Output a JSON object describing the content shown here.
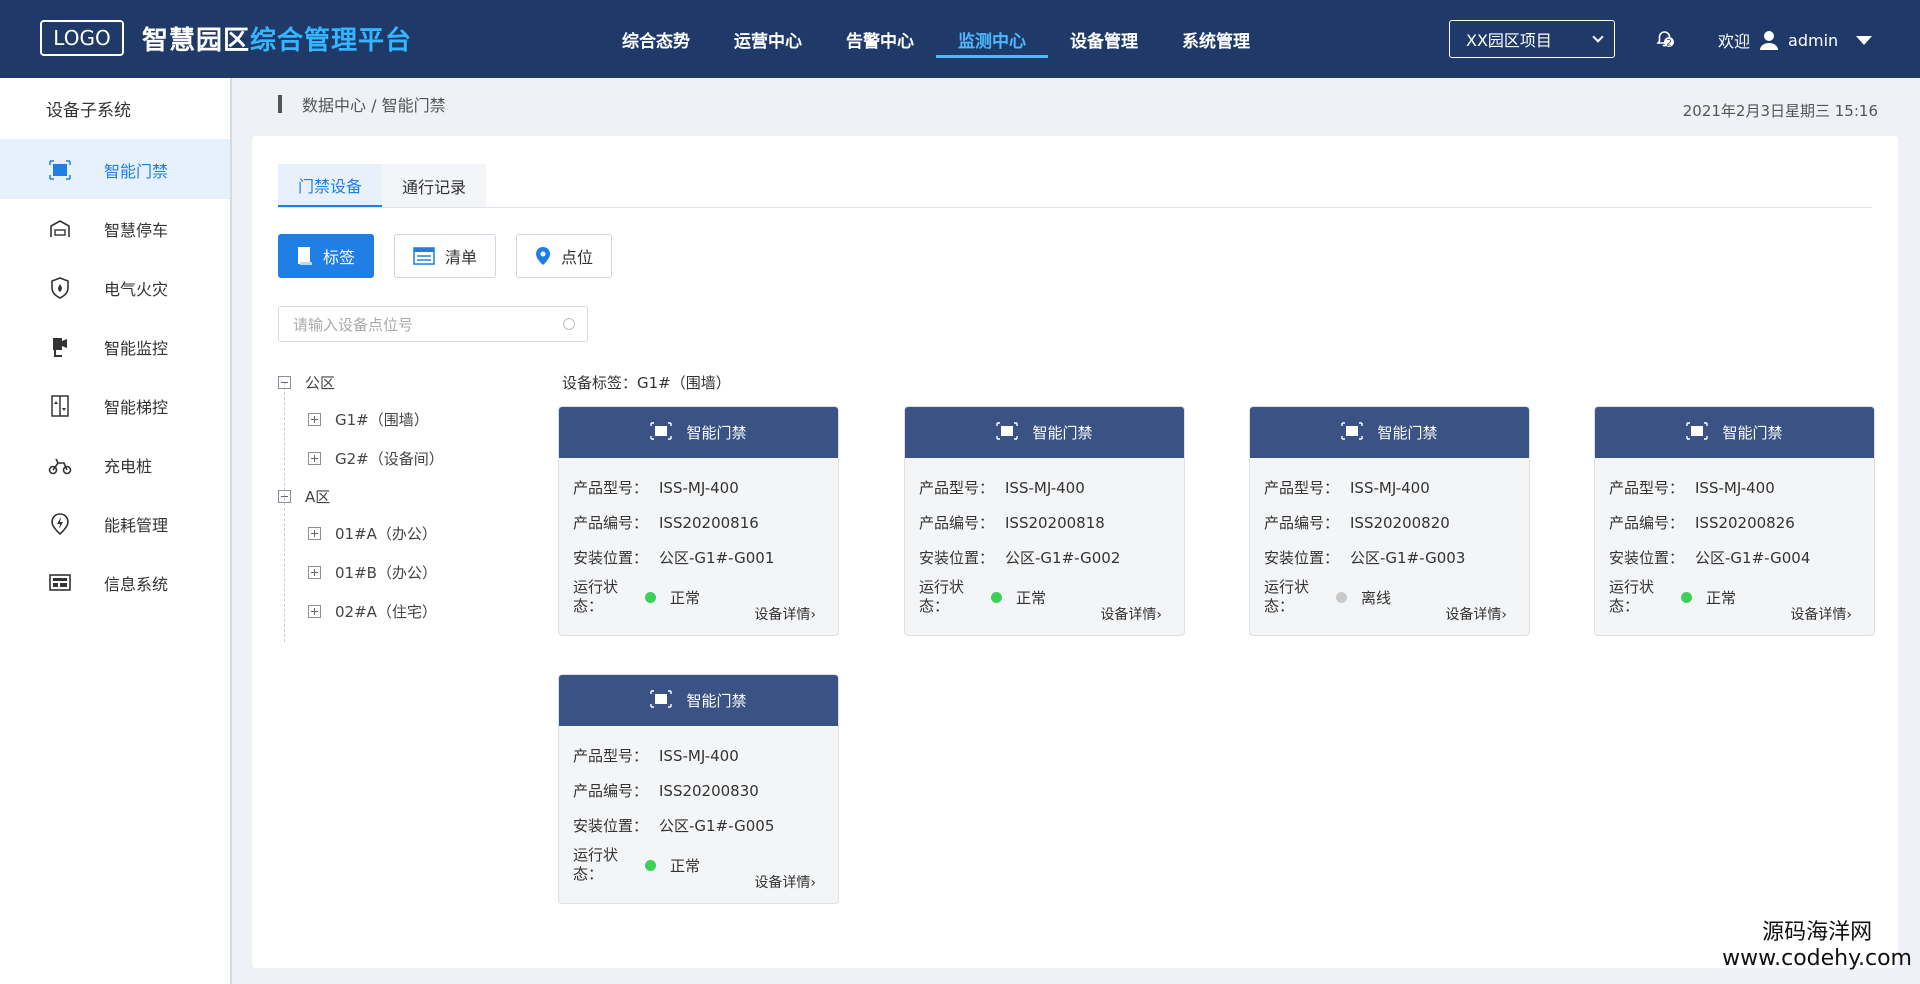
{
  "header": {
    "logo": "LOGO",
    "title_part1": "智慧园区",
    "title_part2": "综合管理平台",
    "nav": [
      "综合态势",
      "运营中心",
      "告警中心",
      "监测中心",
      "设备管理",
      "系统管理"
    ],
    "active_nav": "监测中心",
    "project": "XX园区项目",
    "alert_count": "2",
    "welcome": "欢迎",
    "user": "admin",
    "accent_color": "#33b6ff",
    "bg_color": "#1f3a68"
  },
  "sidebar": {
    "title": "设备子系统",
    "items": [
      {
        "label": "智能门禁",
        "icon": "door-access-icon"
      },
      {
        "label": "智慧停车",
        "icon": "parking-icon"
      },
      {
        "label": "电气火灾",
        "icon": "fire-shield-icon"
      },
      {
        "label": "智能监控",
        "icon": "camera-icon"
      },
      {
        "label": "智能梯控",
        "icon": "elevator-icon"
      },
      {
        "label": "充电桩",
        "icon": "charging-icon"
      },
      {
        "label": "能耗管理",
        "icon": "energy-icon"
      },
      {
        "label": "信息系统",
        "icon": "info-system-icon"
      }
    ]
  },
  "breadcrumb": "数据中心 / 智能门禁",
  "datetime": "2021年2月3日星期三 15:16",
  "tabs": [
    "门禁设备",
    "通行记录"
  ],
  "view_buttons": [
    "标签",
    "清单",
    "点位"
  ],
  "search": {
    "placeholder": "请输入设备点位号"
  },
  "tree": [
    {
      "label": "公区",
      "children": [
        "G1#（围墙）",
        "G2#（设备间）"
      ]
    },
    {
      "label": "A区",
      "children": [
        "01#A（办公）",
        "01#B（办公）",
        "02#A（住宅）"
      ]
    }
  ],
  "tag_label": "设备标签：G1#（围墙）",
  "card_labels": {
    "title": "智能门禁",
    "model": "产品型号：",
    "serial": "产品编号：",
    "location": "安装位置：",
    "status": "运行状态：",
    "detail": "设备详情"
  },
  "cards": [
    {
      "model": "ISS-MJ-400",
      "serial": "ISS20200816",
      "location": "公区-G1#-G001",
      "status": "正常",
      "status_color": "#3ccf5a"
    },
    {
      "model": "ISS-MJ-400",
      "serial": "ISS20200818",
      "location": "公区-G1#-G002",
      "status": "正常",
      "status_color": "#3ccf5a"
    },
    {
      "model": "ISS-MJ-400",
      "serial": "ISS20200820",
      "location": "公区-G1#-G003",
      "status": "离线",
      "status_color": "#c9c9c9"
    },
    {
      "model": "ISS-MJ-400",
      "serial": "ISS20200826",
      "location": "公区-G1#-G004",
      "status": "正常",
      "status_color": "#3ccf5a"
    },
    {
      "model": "ISS-MJ-400",
      "serial": "ISS20200830",
      "location": "公区-G1#-G005",
      "status": "正常",
      "status_color": "#3ccf5a"
    }
  ],
  "watermark": {
    "line1": "源码海洋网",
    "line2": "www.codehy.com"
  }
}
